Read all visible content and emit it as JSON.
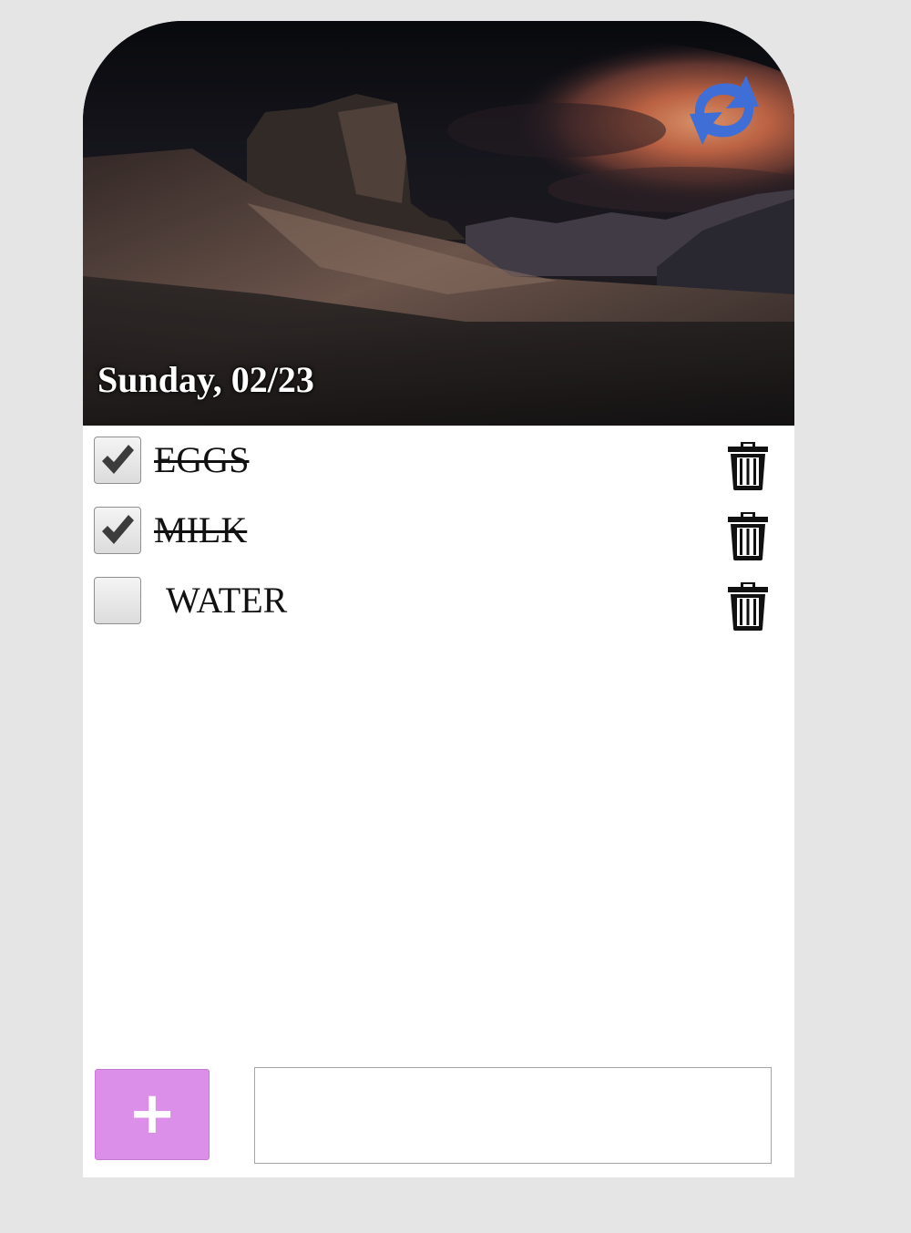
{
  "header": {
    "date": "Sunday, 02/23",
    "refresh_icon": "refresh-icon",
    "accent_color": "#3f6fd6"
  },
  "items": [
    {
      "label": "EGGS",
      "checked": true
    },
    {
      "label": "MILK",
      "checked": true
    },
    {
      "label": "WATER",
      "checked": false
    }
  ],
  "footer": {
    "add_label": "+",
    "add_color": "#dc8fe8",
    "input_placeholder": "",
    "input_value": ""
  }
}
